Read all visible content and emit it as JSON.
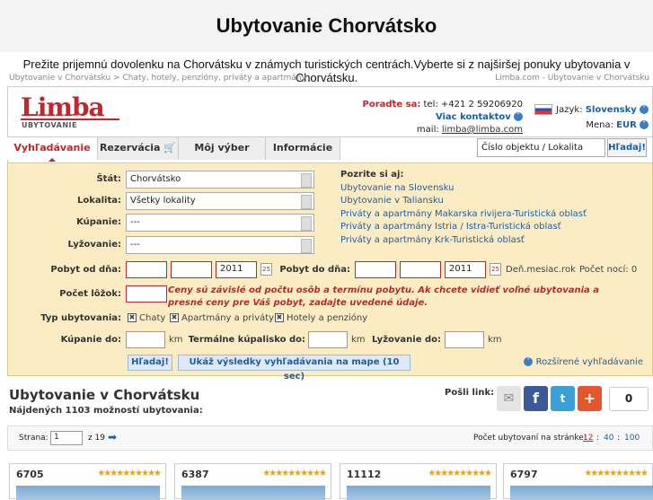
{
  "header": {
    "title": "Ubytovanie Chorvátsko",
    "intro": "Prežite prijemnú dovolenku na Chorvátsku v známych turistických centrách.Vyberte si z najširšej ponuky ubytovania v Chorvátsku.",
    "breadcrumb": "Ubytovanie v Chorvátsku > Chaty, hotely, penzióny, priváty a apartmány",
    "breadcrumb_right": "Limba.com - Ubytovanie v Chorvátsku"
  },
  "brand": {
    "logo": "Limba",
    "tagline": "UBYTOVANIE"
  },
  "contact": {
    "label": "Poraďte sa:",
    "phone": "tel: +421 2 59206920",
    "more": "Viac kontaktov",
    "mail_label": "mail:",
    "mail": "limba@limba.com"
  },
  "settings": {
    "lang_label": "Jazyk:",
    "lang": "Slovensky",
    "currency_label": "Mena:",
    "currency": "EUR"
  },
  "nav": {
    "tabs": [
      "Vyhľadávanie",
      "Rezervácia",
      "Môj výber",
      "Informácie"
    ]
  },
  "search": {
    "placeholder": "Číslo objektu / Lokalita",
    "button": "Hľadaj!"
  },
  "form": {
    "stat_label": "Štát:",
    "stat": "Chorvátsko",
    "lokalita_label": "Lokalita:",
    "lokalita": "Všetky lokality",
    "kupanie_label": "Kúpanie:",
    "kupanie": "---",
    "lyzovanie_label": "Lyžovanie:",
    "lyzovanie": "---",
    "see_also": "Pozrite si aj:",
    "links": [
      "Ubytovanie na Slovensku",
      "Ubytovanie v Taliansku",
      "Priváty a apartmány Makarska rivijera-Turistická oblasť",
      "Priváty a apartmány Istria / Istra-Turistická oblasť",
      "Priváty a apartmány Krk-Turistická oblasť"
    ],
    "from_label": "Pobyt od dňa:",
    "from_year": "2011",
    "to_label": "Pobyt do dňa:",
    "to_year": "2011",
    "date_hint": "Deň.mesiac.rok",
    "nights": "Počet nocí: 0",
    "beds_label": "Počet lôžok:",
    "warning": "Ceny sú závislé od počtu osôb a termínu pobytu. Ak chcete vidieť voľné ubytovania a presné ceny pre Váš pobyt, zadajte uvedené údaje.",
    "type_label": "Typ ubytovania:",
    "types": [
      "Chaty",
      "Apartmány a priváty",
      "Hotely a penzióny"
    ],
    "kupanie_do": "Kúpanie do:",
    "kupalisko_do": "Termálne kúpalisko do:",
    "lyzovanie_do": "Lyžovanie do:",
    "unit": "km",
    "submit": "Hľadaj!",
    "map_button": "Ukáž výsledky vyhľadávania na mape (10 sec)",
    "advanced": "Rozšírené vyhľadávanie"
  },
  "results": {
    "title": "Ubytovanie v Chorvátsku",
    "found": "Nájdených 1103 možností ubytovania:",
    "share_label": "Pošli link:",
    "share_count": "0"
  },
  "pager": {
    "page_label": "Strana:",
    "page": "1",
    "of": "z 19",
    "per_page_label": "Počet ubytovaní na stránke:",
    "per_page": [
      "12",
      "40",
      "100"
    ],
    "sep": ":"
  },
  "cards": [
    {
      "id": "6705"
    },
    {
      "id": "6387"
    },
    {
      "id": "11112"
    },
    {
      "id": "6797"
    }
  ],
  "colors": {
    "brand_red": "#c0262d",
    "link_blue": "#1a5fa6",
    "form_bg": "#fcecc4"
  }
}
